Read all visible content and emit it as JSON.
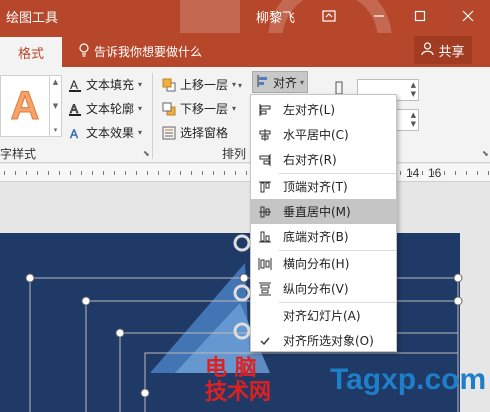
{
  "titlebar": {
    "context_tab": "绘图工具",
    "user": "柳黎飞",
    "bg_color": "#b7472a"
  },
  "tabs": {
    "format": "格式",
    "tell_me": "告诉我你想要做什么",
    "share": "共享"
  },
  "ribbon": {
    "text_fill": "文本填充",
    "text_outline": "文本轮廓",
    "text_effects": "文本效果",
    "wordart_group": "字样式",
    "bring_forward": "上移一层",
    "send_backward": "下移一层",
    "selection_pane": "选择窗格",
    "arrange_group": "排列",
    "align_button": "对齐"
  },
  "ruler": {
    "numbers": [
      "14",
      "16"
    ]
  },
  "align_menu": {
    "items": [
      {
        "label": "左对齐(L)",
        "icon": "align-left-icon"
      },
      {
        "label": "水平居中(C)",
        "icon": "align-center-icon"
      },
      {
        "label": "右对齐(R)",
        "icon": "align-right-icon"
      },
      {
        "label": "顶端对齐(T)",
        "icon": "align-top-icon"
      },
      {
        "label": "垂直居中(M)",
        "icon": "align-middle-icon",
        "highlighted": true
      },
      {
        "label": "底端对齐(B)",
        "icon": "align-bottom-icon"
      },
      {
        "label": "横向分布(H)",
        "icon": "distribute-horizontal-icon"
      },
      {
        "label": "纵向分布(V)",
        "icon": "distribute-vertical-icon"
      },
      {
        "label": "对齐幻灯片(A)",
        "icon": ""
      },
      {
        "label": "对齐所选对象(O)",
        "icon": "checkmark-icon"
      }
    ]
  },
  "watermark": {
    "cn_line1": "电 脑",
    "cn_line2": "技术网",
    "site": "Tagxp.com"
  }
}
